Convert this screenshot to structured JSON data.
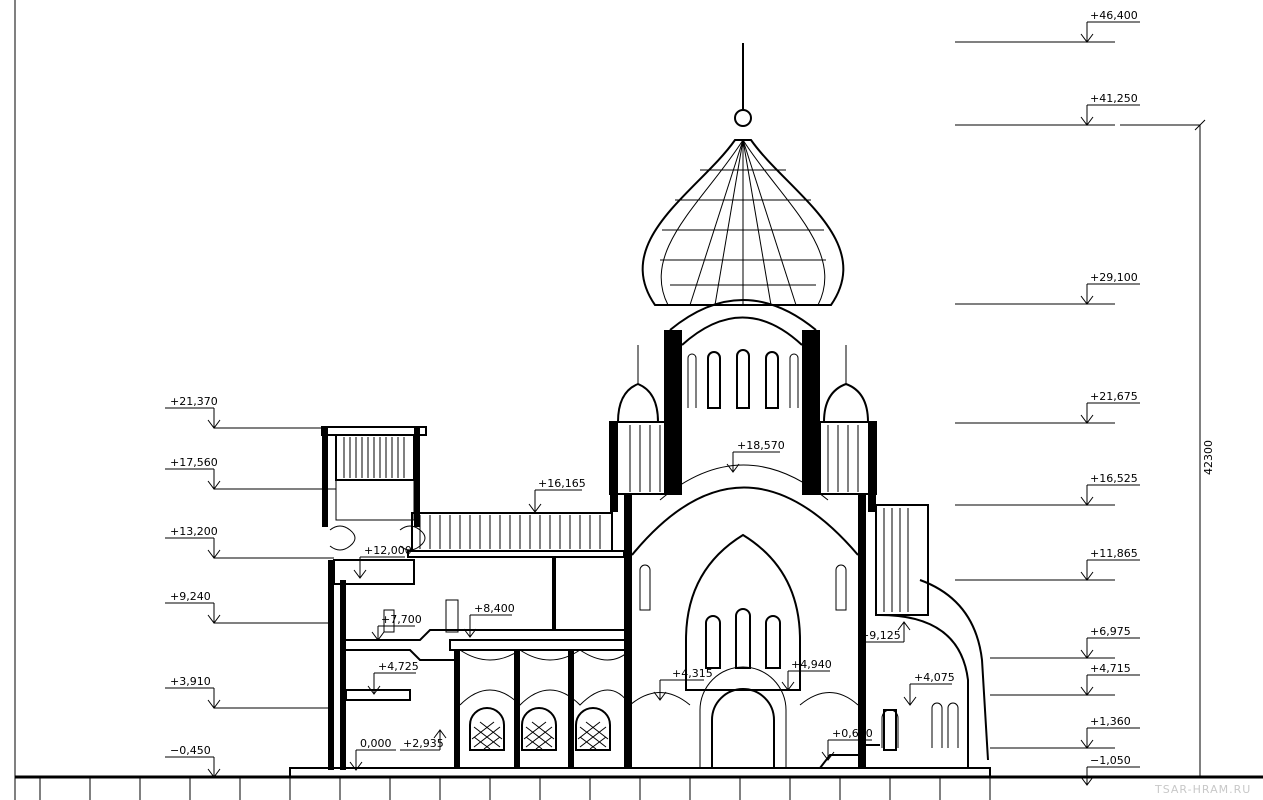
{
  "drawing": {
    "levels_left": [
      "+21,370",
      "+17,560",
      "+13,200",
      "+9,240",
      "+3,910",
      "−0,450"
    ],
    "levels_right": [
      "+46,400",
      "+41,250",
      "+29,100",
      "+21,675",
      "+16,525",
      "+11,865",
      "+6,975",
      "+4,715",
      "+1,360",
      "−1,050"
    ],
    "levels_inner": [
      "+18,570",
      "+16,165",
      "+12,000",
      "+8,400",
      "+7,700",
      "+4,725",
      "+4,315",
      "+4,940",
      "+9,125",
      "+4,075",
      "+0,600",
      "0,000",
      "+2,935"
    ],
    "overall_dimension": "42300",
    "watermark": "TSAR-HRAM.RU"
  }
}
